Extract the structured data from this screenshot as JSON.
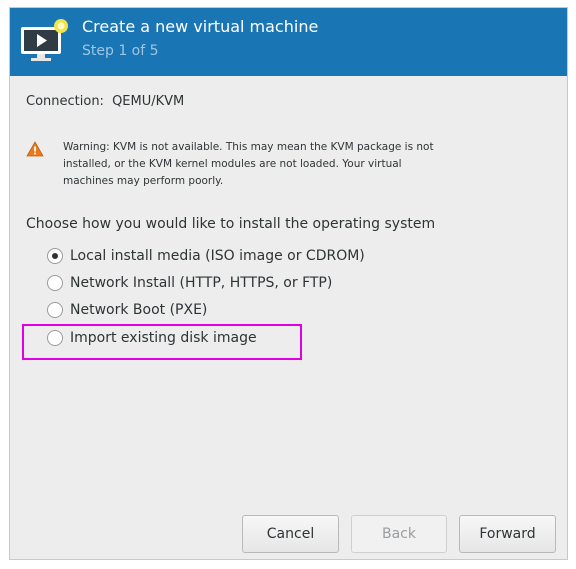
{
  "header": {
    "title": "Create a new virtual machine",
    "step": "Step 1 of 5",
    "icon": "virtual-machine-icon"
  },
  "connection": {
    "label": "Connection:",
    "value": "QEMU/KVM"
  },
  "warning": {
    "icon": "warning-icon",
    "text": "Warning: KVM is not available. This may mean the KVM package is not installed, or the KVM kernel modules are not loaded. Your virtual machines may perform poorly."
  },
  "install": {
    "prompt": "Choose how you would like to install the operating system",
    "options": [
      {
        "label": "Local install media (ISO image or CDROM)",
        "selected": true
      },
      {
        "label": "Network Install (HTTP, HTTPS, or FTP)",
        "selected": false
      },
      {
        "label": "Network Boot (PXE)",
        "selected": false
      },
      {
        "label": "Import existing disk image",
        "selected": false
      }
    ]
  },
  "buttons": {
    "cancel": "Cancel",
    "back": "Back",
    "forward": "Forward"
  },
  "colors": {
    "header_bg": "#1a75b4",
    "highlight": "#e100e1",
    "warning": "#e8791e"
  }
}
